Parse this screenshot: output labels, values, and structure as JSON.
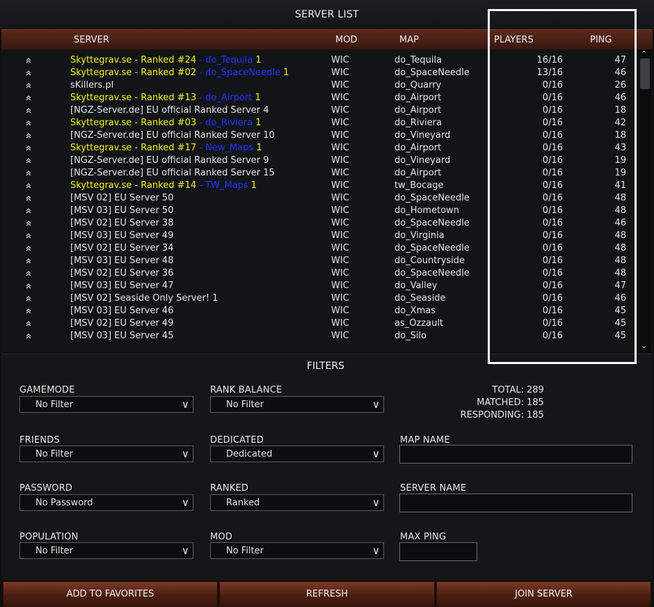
{
  "title": "SERVER LIST",
  "columns": {
    "server": "SERVER",
    "mod": "MOD",
    "map": "MAP",
    "players": "PLAYERS",
    "ping": "PING"
  },
  "rows": [
    {
      "parts": [
        {
          "t": "Skyttegrav.se - Ranked #24",
          "c": "y"
        },
        {
          "t": " - do_Tequila",
          "c": "b"
        },
        {
          "t": " 1",
          "c": "y"
        }
      ],
      "mod": "WIC",
      "map": "do_Tequila",
      "players": "16/16",
      "ping": "47"
    },
    {
      "parts": [
        {
          "t": "Skyttegrav.se - Ranked #02",
          "c": "y"
        },
        {
          "t": " - do_SpaceNeedle",
          "c": "b"
        },
        {
          "t": " 1",
          "c": "y"
        }
      ],
      "mod": "WIC",
      "map": "do_SpaceNeedle",
      "players": "13/16",
      "ping": "46"
    },
    {
      "parts": [
        {
          "t": "sKillers.pl",
          "c": "w"
        }
      ],
      "mod": "WIC",
      "map": "do_Quarry",
      "players": "0/16",
      "ping": "26"
    },
    {
      "parts": [
        {
          "t": "Skyttegrav.se - Ranked #13",
          "c": "y"
        },
        {
          "t": " - do_Airport",
          "c": "b"
        },
        {
          "t": " 1",
          "c": "y"
        }
      ],
      "mod": "WIC",
      "map": "do_Airport",
      "players": "0/16",
      "ping": "46"
    },
    {
      "parts": [
        {
          "t": "[NGZ-Server.de] EU official Ranked Server 4",
          "c": "w"
        }
      ],
      "mod": "WIC",
      "map": "do_Airport",
      "players": "0/16",
      "ping": "18"
    },
    {
      "parts": [
        {
          "t": "Skyttegrav.se - Ranked #03",
          "c": "y"
        },
        {
          "t": " - do_Riviera",
          "c": "b"
        },
        {
          "t": " 1",
          "c": "y"
        }
      ],
      "mod": "WIC",
      "map": "do_Riviera",
      "players": "0/16",
      "ping": "42"
    },
    {
      "parts": [
        {
          "t": "[NGZ-Server.de] EU official Ranked Server 10",
          "c": "w"
        }
      ],
      "mod": "WIC",
      "map": "do_Vineyard",
      "players": "0/16",
      "ping": "18"
    },
    {
      "parts": [
        {
          "t": "Skyttegrav.se - Ranked #17",
          "c": "y"
        },
        {
          "t": " - New_Maps",
          "c": "b"
        },
        {
          "t": " 1",
          "c": "y"
        }
      ],
      "mod": "WIC",
      "map": "do_Airport",
      "players": "0/16",
      "ping": "43"
    },
    {
      "parts": [
        {
          "t": "[NGZ-Server.de] EU official Ranked Server 9",
          "c": "w"
        }
      ],
      "mod": "WIC",
      "map": "do_Vineyard",
      "players": "0/16",
      "ping": "19"
    },
    {
      "parts": [
        {
          "t": "[NGZ-Server.de] EU official Ranked Server 15",
          "c": "w"
        }
      ],
      "mod": "WIC",
      "map": "do_Airport",
      "players": "0/16",
      "ping": "19"
    },
    {
      "parts": [
        {
          "t": "Skyttegrav.se - Ranked #14",
          "c": "y"
        },
        {
          "t": " - TW_Maps",
          "c": "b"
        },
        {
          "t": " 1",
          "c": "y"
        }
      ],
      "mod": "WIC",
      "map": "tw_Bocage",
      "players": "0/16",
      "ping": "41"
    },
    {
      "parts": [
        {
          "t": "[MSV 02] EU Server 50",
          "c": "w"
        }
      ],
      "mod": "WIC",
      "map": "do_SpaceNeedle",
      "players": "0/16",
      "ping": "48"
    },
    {
      "parts": [
        {
          "t": "[MSV 03] EU Server 50",
          "c": "w"
        }
      ],
      "mod": "WIC",
      "map": "do_Hometown",
      "players": "0/16",
      "ping": "48"
    },
    {
      "parts": [
        {
          "t": "[MSV 02] EU Server 38",
          "c": "w"
        }
      ],
      "mod": "WIC",
      "map": "do_SpaceNeedle",
      "players": "0/16",
      "ping": "46"
    },
    {
      "parts": [
        {
          "t": "[MSV 03] EU Server 49",
          "c": "w"
        }
      ],
      "mod": "WIC",
      "map": "do_Virginia",
      "players": "0/16",
      "ping": "48"
    },
    {
      "parts": [
        {
          "t": "[MSV 02] EU Server 34",
          "c": "w"
        }
      ],
      "mod": "WIC",
      "map": "do_SpaceNeedle",
      "players": "0/16",
      "ping": "48"
    },
    {
      "parts": [
        {
          "t": "[MSV 03] EU Server 48",
          "c": "w"
        }
      ],
      "mod": "WIC",
      "map": "do_Countryside",
      "players": "0/16",
      "ping": "48"
    },
    {
      "parts": [
        {
          "t": "[MSV 02] EU Server 36",
          "c": "w"
        }
      ],
      "mod": "WIC",
      "map": "do_SpaceNeedle",
      "players": "0/16",
      "ping": "48"
    },
    {
      "parts": [
        {
          "t": "[MSV 03] EU Server 47",
          "c": "w"
        }
      ],
      "mod": "WIC",
      "map": "do_Valley",
      "players": "0/16",
      "ping": "47"
    },
    {
      "parts": [
        {
          "t": "[MSV 02] Seaside Only Server! 1",
          "c": "w"
        }
      ],
      "mod": "WIC",
      "map": "do_Seaside",
      "players": "0/16",
      "ping": "46"
    },
    {
      "parts": [
        {
          "t": "[MSV 03] EU Server 46",
          "c": "w"
        }
      ],
      "mod": "WIC",
      "map": "do_Xmas",
      "players": "0/16",
      "ping": "45"
    },
    {
      "parts": [
        {
          "t": "[MSV 02] EU Server 49",
          "c": "w"
        }
      ],
      "mod": "WIC",
      "map": "as_Ozzault",
      "players": "0/16",
      "ping": "45"
    },
    {
      "parts": [
        {
          "t": "[MSV 03] EU Server 45",
          "c": "w"
        }
      ],
      "mod": "WIC",
      "map": "do_Silo",
      "players": "0/16",
      "ping": "45"
    }
  ],
  "filters": {
    "title": "FILTERS",
    "gamemode": {
      "label": "GAMEMODE",
      "value": "No Filter"
    },
    "rank_balance": {
      "label": "RANK BALANCE",
      "value": "No Filter"
    },
    "friends": {
      "label": "FRIENDS",
      "value": "No Filter"
    },
    "dedicated": {
      "label": "DEDICATED",
      "value": "Dedicated"
    },
    "password": {
      "label": "PASSWORD",
      "value": "No Password"
    },
    "ranked": {
      "label": "RANKED",
      "value": "Ranked"
    },
    "population": {
      "label": "POPULATION",
      "value": "No Filter"
    },
    "mod": {
      "label": "MOD",
      "value": "No Filter"
    },
    "map_name": {
      "label": "MAP NAME",
      "value": ""
    },
    "server_name": {
      "label": "SERVER NAME",
      "value": ""
    },
    "max_ping": {
      "label": "MAX PING",
      "value": ""
    }
  },
  "stats": {
    "total_label": "TOTAL:",
    "total": "289",
    "matched_label": "MATCHED:",
    "matched": "185",
    "responding_label": "RESPONDING:",
    "responding": "185"
  },
  "buttons": {
    "add_favorites": "ADD TO FAVORITES",
    "refresh": "REFRESH",
    "join": "JOIN SERVER"
  },
  "icons": {
    "row_icon": "chevron-up-icon",
    "select_arrow": "chevron-down-icon"
  },
  "colors": {
    "ranked_name": "#f2f21e",
    "ranked_map_tag": "#2233ff",
    "header_bar": "#5a2a1c",
    "button": "#6a2e1c"
  }
}
